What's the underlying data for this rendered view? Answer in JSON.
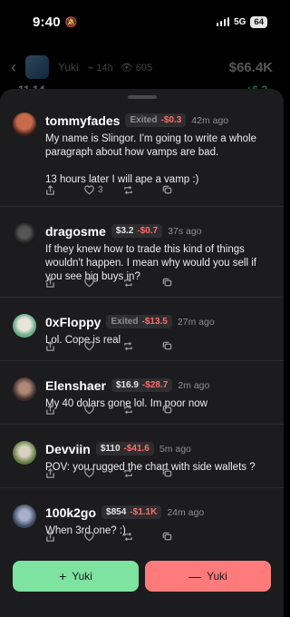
{
  "status": {
    "time": "9:40",
    "network": "5G",
    "battery": "64"
  },
  "header": {
    "token_name": "Yuki",
    "age": "14h",
    "views": "605",
    "price": "$66.4K"
  },
  "peek": {
    "left": "11.14",
    "right": "+6.2"
  },
  "comments": [
    {
      "user": "tommyfades",
      "holding": "Exited",
      "pnl": "-$0.3",
      "time": "42m ago",
      "text": "My name is Slingor. I'm going to write a whole paragraph about how vamps are bad.\n\n13 hours later I will ape a vamp :)",
      "likes": "3"
    },
    {
      "user": "dragosme",
      "holding": "$3.2",
      "pnl": "-$0.7",
      "time": "37s ago",
      "text": "If they knew how to trade this kind of things wouldn't happen. I mean why would you sell if you see big buys in?",
      "likes": ""
    },
    {
      "user": "0xFloppy",
      "holding": "Exited",
      "pnl": "-$13.5",
      "time": "27m ago",
      "text": "Lol. Cope is real",
      "likes": ""
    },
    {
      "user": "Elenshaer",
      "holding": "$16.9",
      "pnl": "-$28.7",
      "time": "2m ago",
      "text": "My 40 dolars gone lol. Im poor now",
      "likes": ""
    },
    {
      "user": "Devviin",
      "holding": "$110",
      "pnl": "-$41.6",
      "time": "5m ago",
      "text": "POV: you rugged the chart with side wallets ?",
      "likes": ""
    },
    {
      "user": "100k2go",
      "holding": "$854",
      "pnl": "-$1.1K",
      "time": "24m ago",
      "text": "When 3rd one? :)",
      "likes": ""
    }
  ],
  "buttons": {
    "buy": "Yuki",
    "buy_symbol": "+",
    "sell": "Yuki",
    "sell_symbol": "—"
  },
  "colors": {
    "buy": "#7ee2a0",
    "sell": "#ff7b7b",
    "negative": "#ff6b6b",
    "positive": "#4ade80"
  }
}
